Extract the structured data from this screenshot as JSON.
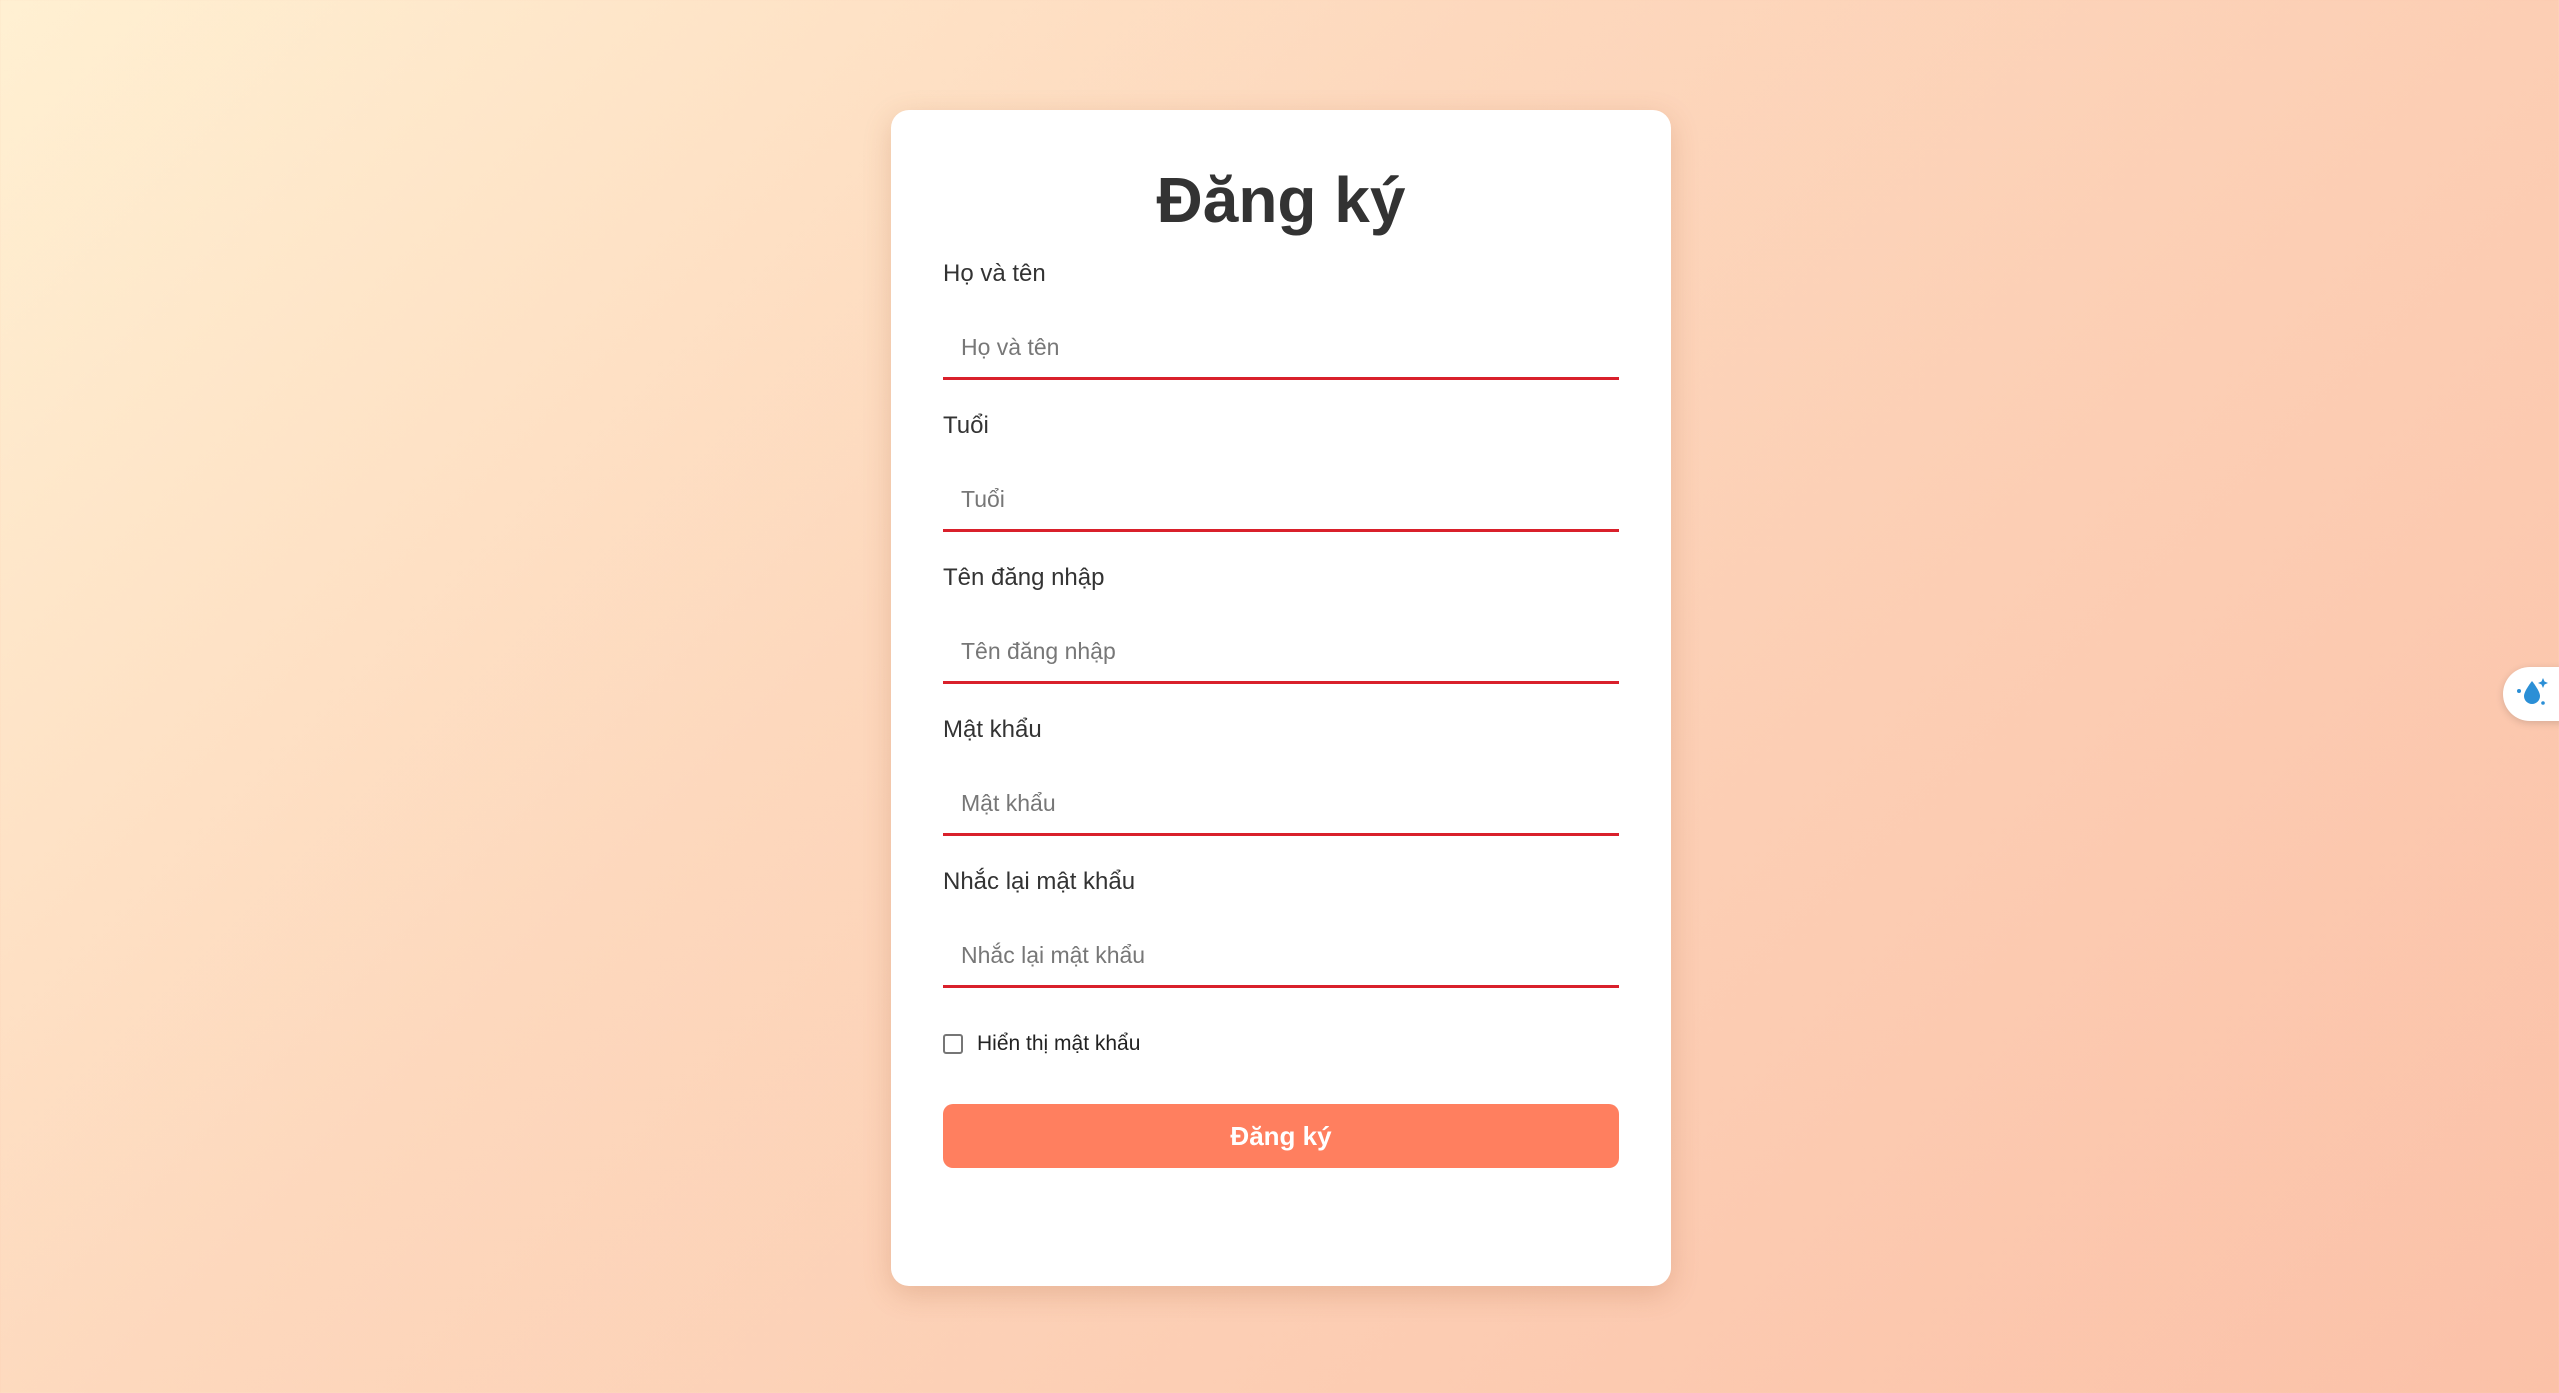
{
  "form": {
    "title": "Đăng ký",
    "fields": [
      {
        "label": "Họ và tên",
        "placeholder": "Họ và tên",
        "value": ""
      },
      {
        "label": "Tuổi",
        "placeholder": "Tuổi",
        "value": ""
      },
      {
        "label": "Tên đăng nhập",
        "placeholder": "Tên đăng nhập",
        "value": ""
      },
      {
        "label": "Mật khẩu",
        "placeholder": "Mật khẩu",
        "value": ""
      },
      {
        "label": "Nhắc lại mật khẩu",
        "placeholder": "Nhắc lại mật khẩu",
        "value": ""
      }
    ],
    "show_password_label": "Hiển thị mật khẩu",
    "show_password_checked": false,
    "submit_label": "Đăng ký"
  },
  "extension_tab": {
    "icon": "water-drop-sparkle-icon"
  },
  "colors": {
    "accent": "#ff7f5f",
    "input_underline": "#d9202b",
    "title_text": "#333333"
  }
}
